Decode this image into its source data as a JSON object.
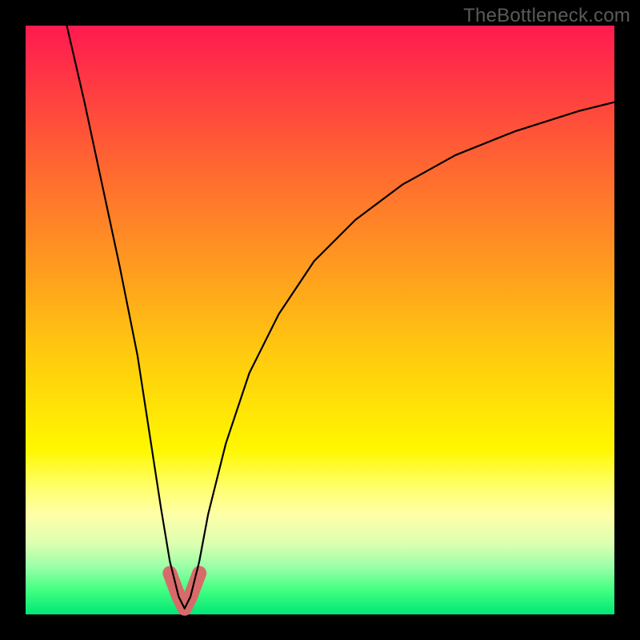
{
  "watermark": "TheBottleneck.com",
  "colors": {
    "frame_border": "#000000",
    "curve": "#000000",
    "highlight": "#d86a6a",
    "gradient_top": "#ff1a50",
    "gradient_bottom": "#00e676"
  },
  "chart_data": {
    "type": "line",
    "title": "",
    "xlabel": "",
    "ylabel": "",
    "xlim": [
      0,
      100
    ],
    "ylim": [
      0,
      100
    ],
    "x_min_point": 27,
    "series": [
      {
        "name": "bottleneck-curve",
        "x": [
          7,
          10,
          13,
          16,
          19,
          21,
          23,
          24.5,
          26,
          27,
          28,
          29.5,
          31,
          34,
          38,
          43,
          49,
          56,
          64,
          73,
          83,
          94,
          100
        ],
        "y": [
          100,
          87,
          73,
          59,
          44,
          31,
          18,
          9,
          3,
          1,
          3,
          9,
          17,
          29,
          41,
          51,
          60,
          67,
          73,
          78,
          82,
          85.5,
          87
        ]
      },
      {
        "name": "highlight-segment",
        "x": [
          24.5,
          26,
          27,
          28,
          29.5
        ],
        "y": [
          7,
          3,
          1,
          3,
          7
        ]
      }
    ]
  }
}
